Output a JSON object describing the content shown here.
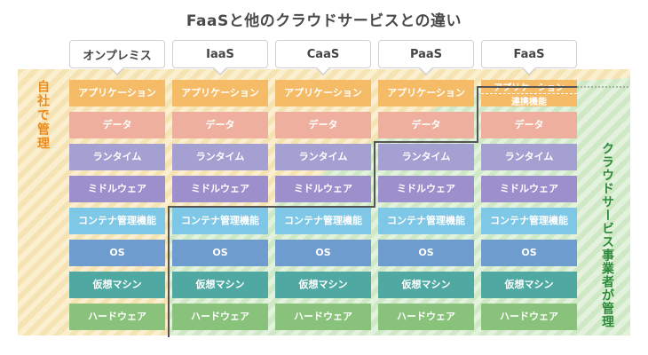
{
  "title": "FaaSと他のクラウドサービスとの違い",
  "columns": [
    "オンプレミス",
    "IaaS",
    "CaaS",
    "PaaS",
    "FaaS"
  ],
  "layers": [
    "アプリケーション",
    "データ",
    "ランタイム",
    "ミドルウェア",
    "コンテナ管理機能",
    "OS",
    "仮想マシン",
    "ハードウェア"
  ],
  "faas_app_top": "アプリケーション",
  "faas_app_bottom": "連携機能",
  "side_left": "自社で管理",
  "side_right": "クラウドサービス事業者が管理",
  "colors": {
    "self_managed": "#f6e3b3",
    "vendor_managed": "#cfe8c6",
    "side_left_text": "#ec8a1a",
    "side_right_text": "#2d8a3a"
  }
}
